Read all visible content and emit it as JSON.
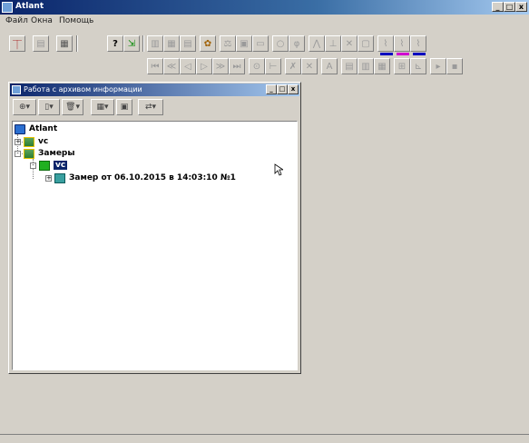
{
  "app": {
    "title": "Atlant"
  },
  "window_controls": {
    "minimize": "_",
    "maximize": "□",
    "close": "x"
  },
  "menu": [
    "Файл",
    "Окна",
    "Помощь"
  ],
  "child_window": {
    "title": "Работа с архивом информации",
    "controls": {
      "minimize": "_",
      "maximize": "□",
      "close": "x"
    },
    "toolbar": [
      "add-folder",
      "new",
      "delete",
      "view",
      "calc",
      "link"
    ]
  },
  "tree": {
    "root": "Atlant",
    "nodes": [
      {
        "label": "vc",
        "expand": "+"
      },
      {
        "label": "Замеры",
        "expand": "-"
      },
      {
        "label": "vc",
        "expand": "-",
        "selected": true
      },
      {
        "label": "Замер от 06.10.2015 в 14:03:10  №1",
        "expand": "+"
      }
    ]
  },
  "toolbar_icons": [
    "signal-icon",
    "print-icon",
    "chart-icon",
    "help-icon",
    "export-icon"
  ]
}
